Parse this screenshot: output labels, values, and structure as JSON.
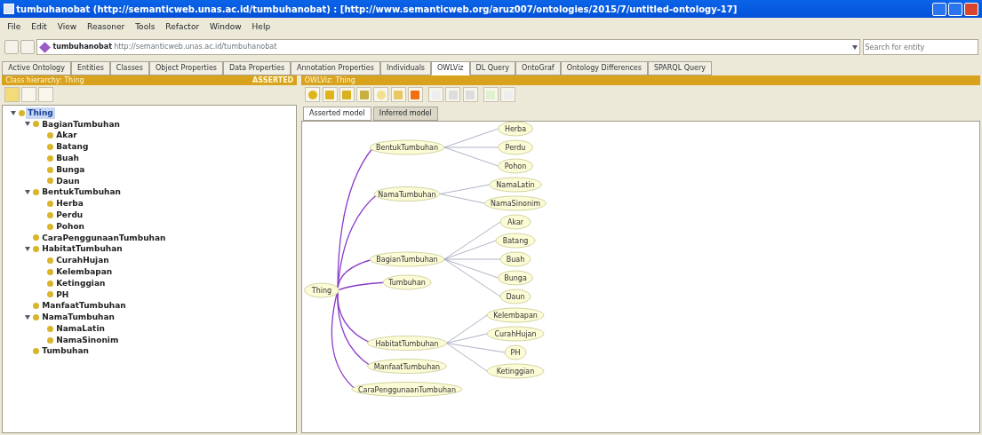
{
  "window": {
    "title": "tumbuhanobat (http://semanticweb.unas.ac.id/tumbuhanobat) : [http://www.semanticweb.org/aruz007/ontologies/2015/7/untitled-ontology-17]"
  },
  "menu": [
    "File",
    "Edit",
    "View",
    "Reasoner",
    "Tools",
    "Refactor",
    "Window",
    "Help"
  ],
  "address": {
    "name": "tumbuhanobat",
    "url": "http://semanticweb.unas.ac.id/tumbuhanobat"
  },
  "search": {
    "placeholder": "Search for entity"
  },
  "tabs": [
    {
      "label": "Active Ontology",
      "selected": false
    },
    {
      "label": "Entities",
      "selected": false
    },
    {
      "label": "Classes",
      "selected": false
    },
    {
      "label": "Object Properties",
      "selected": false
    },
    {
      "label": "Data Properties",
      "selected": false
    },
    {
      "label": "Annotation Properties",
      "selected": false
    },
    {
      "label": "Individuals",
      "selected": false
    },
    {
      "label": "OWLViz",
      "selected": true
    },
    {
      "label": "DL Query",
      "selected": false
    },
    {
      "label": "OntoGraf",
      "selected": false
    },
    {
      "label": "Ontology Differences",
      "selected": false
    },
    {
      "label": "SPARQL Query",
      "selected": false
    }
  ],
  "class_hierarchy": {
    "title": "Class hierarchy: Thing",
    "mode": "ASSERTED",
    "tree": [
      {
        "label": "Thing",
        "selected": true,
        "expanded": true,
        "children": [
          {
            "label": "BagianTumbuhan",
            "selected": false,
            "expanded": true,
            "children": [
              {
                "label": "Akar",
                "selected": false
              },
              {
                "label": "Batang",
                "selected": false
              },
              {
                "label": "Buah",
                "selected": false
              },
              {
                "label": "Bunga",
                "selected": false
              },
              {
                "label": "Daun",
                "selected": false
              }
            ]
          },
          {
            "label": "BentukTumbuhan",
            "selected": false,
            "expanded": true,
            "children": [
              {
                "label": "Herba",
                "selected": false
              },
              {
                "label": "Perdu",
                "selected": false
              },
              {
                "label": "Pohon",
                "selected": false
              }
            ]
          },
          {
            "label": "CaraPenggunaanTumbuhan",
            "selected": false
          },
          {
            "label": "HabitatTumbuhan",
            "selected": false,
            "expanded": true,
            "children": [
              {
                "label": "CurahHujan",
                "selected": false
              },
              {
                "label": "Kelembapan",
                "selected": false
              },
              {
                "label": "Ketinggian",
                "selected": false
              },
              {
                "label": "PH",
                "selected": false
              }
            ]
          },
          {
            "label": "ManfaatTumbuhan",
            "selected": false
          },
          {
            "label": "NamaTumbuhan",
            "selected": false,
            "expanded": true,
            "children": [
              {
                "label": "NamaLatin",
                "selected": false
              },
              {
                "label": "NamaSinonim",
                "selected": false
              }
            ]
          },
          {
            "label": "Tumbuhan",
            "selected": false
          }
        ]
      }
    ]
  },
  "owlviz": {
    "title": "OWLViz: Thing",
    "model_tabs": [
      {
        "label": "Asserted model",
        "selected": true
      },
      {
        "label": "Inferred model",
        "selected": false
      }
    ],
    "graph": {
      "root": "Thing",
      "groups": [
        {
          "label": "BentukTumbuhan",
          "children": [
            "Herba",
            "Perdu",
            "Pohon"
          ]
        },
        {
          "label": "NamaTumbuhan",
          "children": [
            "NamaLatin",
            "NamaSinonim"
          ]
        },
        {
          "label": "BagianTumbuhan",
          "children": [
            "Akar",
            "Batang",
            "Buah",
            "Bunga",
            "Daun"
          ]
        },
        {
          "label": "Tumbuhan"
        },
        {
          "label": "HabitatTumbuhan",
          "children": [
            "Kelembapan",
            "CurahHujan",
            "PH",
            "Ketinggian"
          ]
        },
        {
          "label": "ManfaatTumbuhan"
        },
        {
          "label": "CaraPenggunaanTumbuhan"
        }
      ]
    }
  }
}
